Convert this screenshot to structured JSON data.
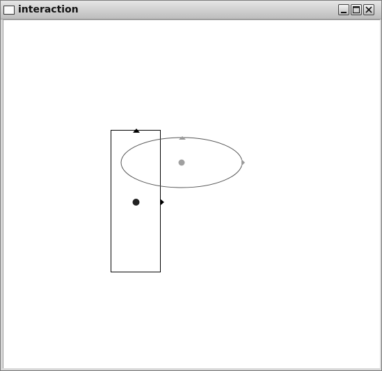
{
  "window": {
    "title": "interaction",
    "controls": {
      "minimize_icon": "minimize-icon",
      "maximize_icon": "maximize-icon",
      "close_icon": "close-icon"
    }
  },
  "canvas": {
    "background": "#ffffff",
    "shapes": [
      {
        "name": "rectangle",
        "stroke": "#000000",
        "fill": "none",
        "handles": [
          {
            "name": "rectangle-top-handle",
            "glyph": "triangle-up",
            "color": "#000000"
          },
          {
            "name": "rectangle-right-handle",
            "glyph": "triangle-right",
            "color": "#000000"
          },
          {
            "name": "rectangle-center-point",
            "glyph": "dot",
            "color": "#222222"
          }
        ]
      },
      {
        "name": "ellipse",
        "stroke": "#555555",
        "fill": "none",
        "handles": [
          {
            "name": "ellipse-top-handle",
            "glyph": "triangle-up",
            "color": "#9a9a9a"
          },
          {
            "name": "ellipse-right-handle",
            "glyph": "triangle-right",
            "color": "#9a9a9a"
          },
          {
            "name": "ellipse-center-point",
            "glyph": "dot",
            "color": "#a0a0a0"
          }
        ]
      }
    ]
  }
}
